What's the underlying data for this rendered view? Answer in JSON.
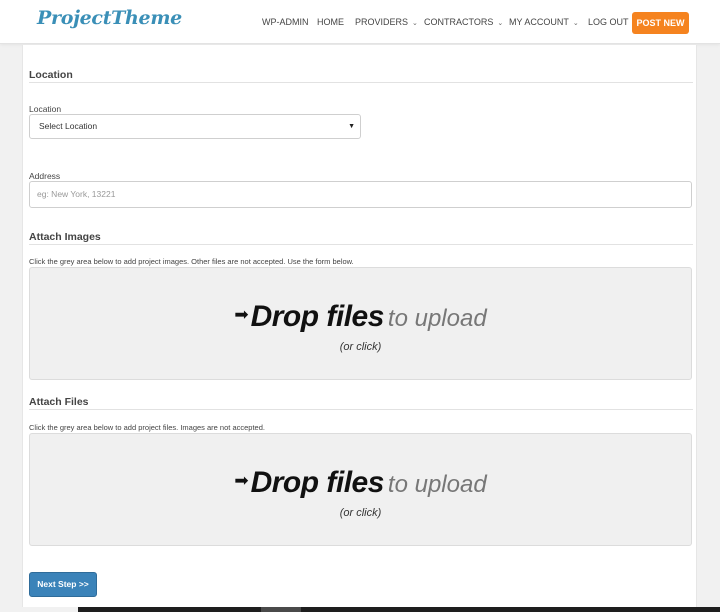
{
  "header": {
    "logo": "ProjectTheme",
    "nav": [
      {
        "label": "WP-ADMIN",
        "dropdown": false
      },
      {
        "label": "HOME",
        "dropdown": false
      },
      {
        "label": "PROVIDERS",
        "dropdown": true
      },
      {
        "label": "CONTRACTORS",
        "dropdown": true
      },
      {
        "label": "MY ACCOUNT",
        "dropdown": true
      },
      {
        "label": "LOG OUT",
        "dropdown": false
      }
    ],
    "post_button": "POST NEW"
  },
  "location_section": {
    "title": "Location",
    "location_label": "Location",
    "location_selected": "Select Location",
    "address_label": "Address",
    "address_placeholder": "eg: New York, 13221"
  },
  "images_section": {
    "title": "Attach Images",
    "help": "Click the grey area below to add project images. Other files are not accepted. Use the form below.",
    "drop_strong": "Drop files",
    "drop_light": "to upload",
    "drop_sub": "(or click)"
  },
  "files_section": {
    "title": "Attach Files",
    "help": "Click the grey area below to add project files. Images are not accepted.",
    "drop_strong": "Drop files",
    "drop_light": "to upload",
    "drop_sub": "(or click)"
  },
  "next_button": "Next Step >>",
  "colors": {
    "brand": "#3a8fb7",
    "post_button": "#f5831f",
    "next_button": "#3b83b9"
  },
  "icons": {
    "dropdown": "chevron-down-icon",
    "select_caret": "caret-down-icon",
    "drop_arrow": "arrow-right-icon"
  }
}
